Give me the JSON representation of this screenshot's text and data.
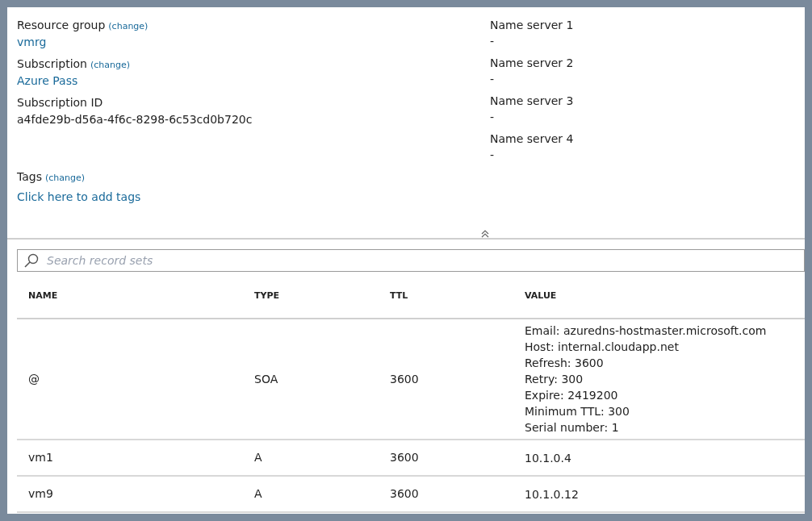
{
  "essentials_left": [
    {
      "label": "Resource group",
      "change": "(change)",
      "value": "vmrg",
      "kind": "link"
    },
    {
      "label": "Subscription",
      "change": "(change)",
      "value": "Azure Pass",
      "kind": "link"
    },
    {
      "label": "Subscription ID",
      "value": "a4fde29b-d56a-4f6c-8298-6c53cd0b720c",
      "kind": "text"
    }
  ],
  "tags": {
    "label": "Tags",
    "change": "(change)",
    "link": "Click here to add tags"
  },
  "essentials_right": [
    {
      "label": "Name server 1",
      "value": "-"
    },
    {
      "label": "Name server 2",
      "value": "-"
    },
    {
      "label": "Name server 3",
      "value": "-"
    },
    {
      "label": "Name server 4",
      "value": "-"
    }
  ],
  "search": {
    "placeholder": "Search record sets"
  },
  "table": {
    "columns": [
      "NAME",
      "TYPE",
      "TTL",
      "VALUE"
    ],
    "rows": [
      {
        "name": "@",
        "type": "SOA",
        "ttl": "3600",
        "value": [
          "Email: azuredns-hostmaster.microsoft.com",
          "Host: internal.cloudapp.net",
          "Refresh: 3600",
          "Retry: 300",
          "Expire: 2419200",
          "Minimum TTL: 300",
          "Serial number: 1"
        ]
      },
      {
        "name": "vm1",
        "type": "A",
        "ttl": "3600",
        "value": [
          "10.1.0.4"
        ]
      },
      {
        "name": "vm9",
        "type": "A",
        "ttl": "3600",
        "value": [
          "10.1.0.12"
        ]
      }
    ]
  }
}
